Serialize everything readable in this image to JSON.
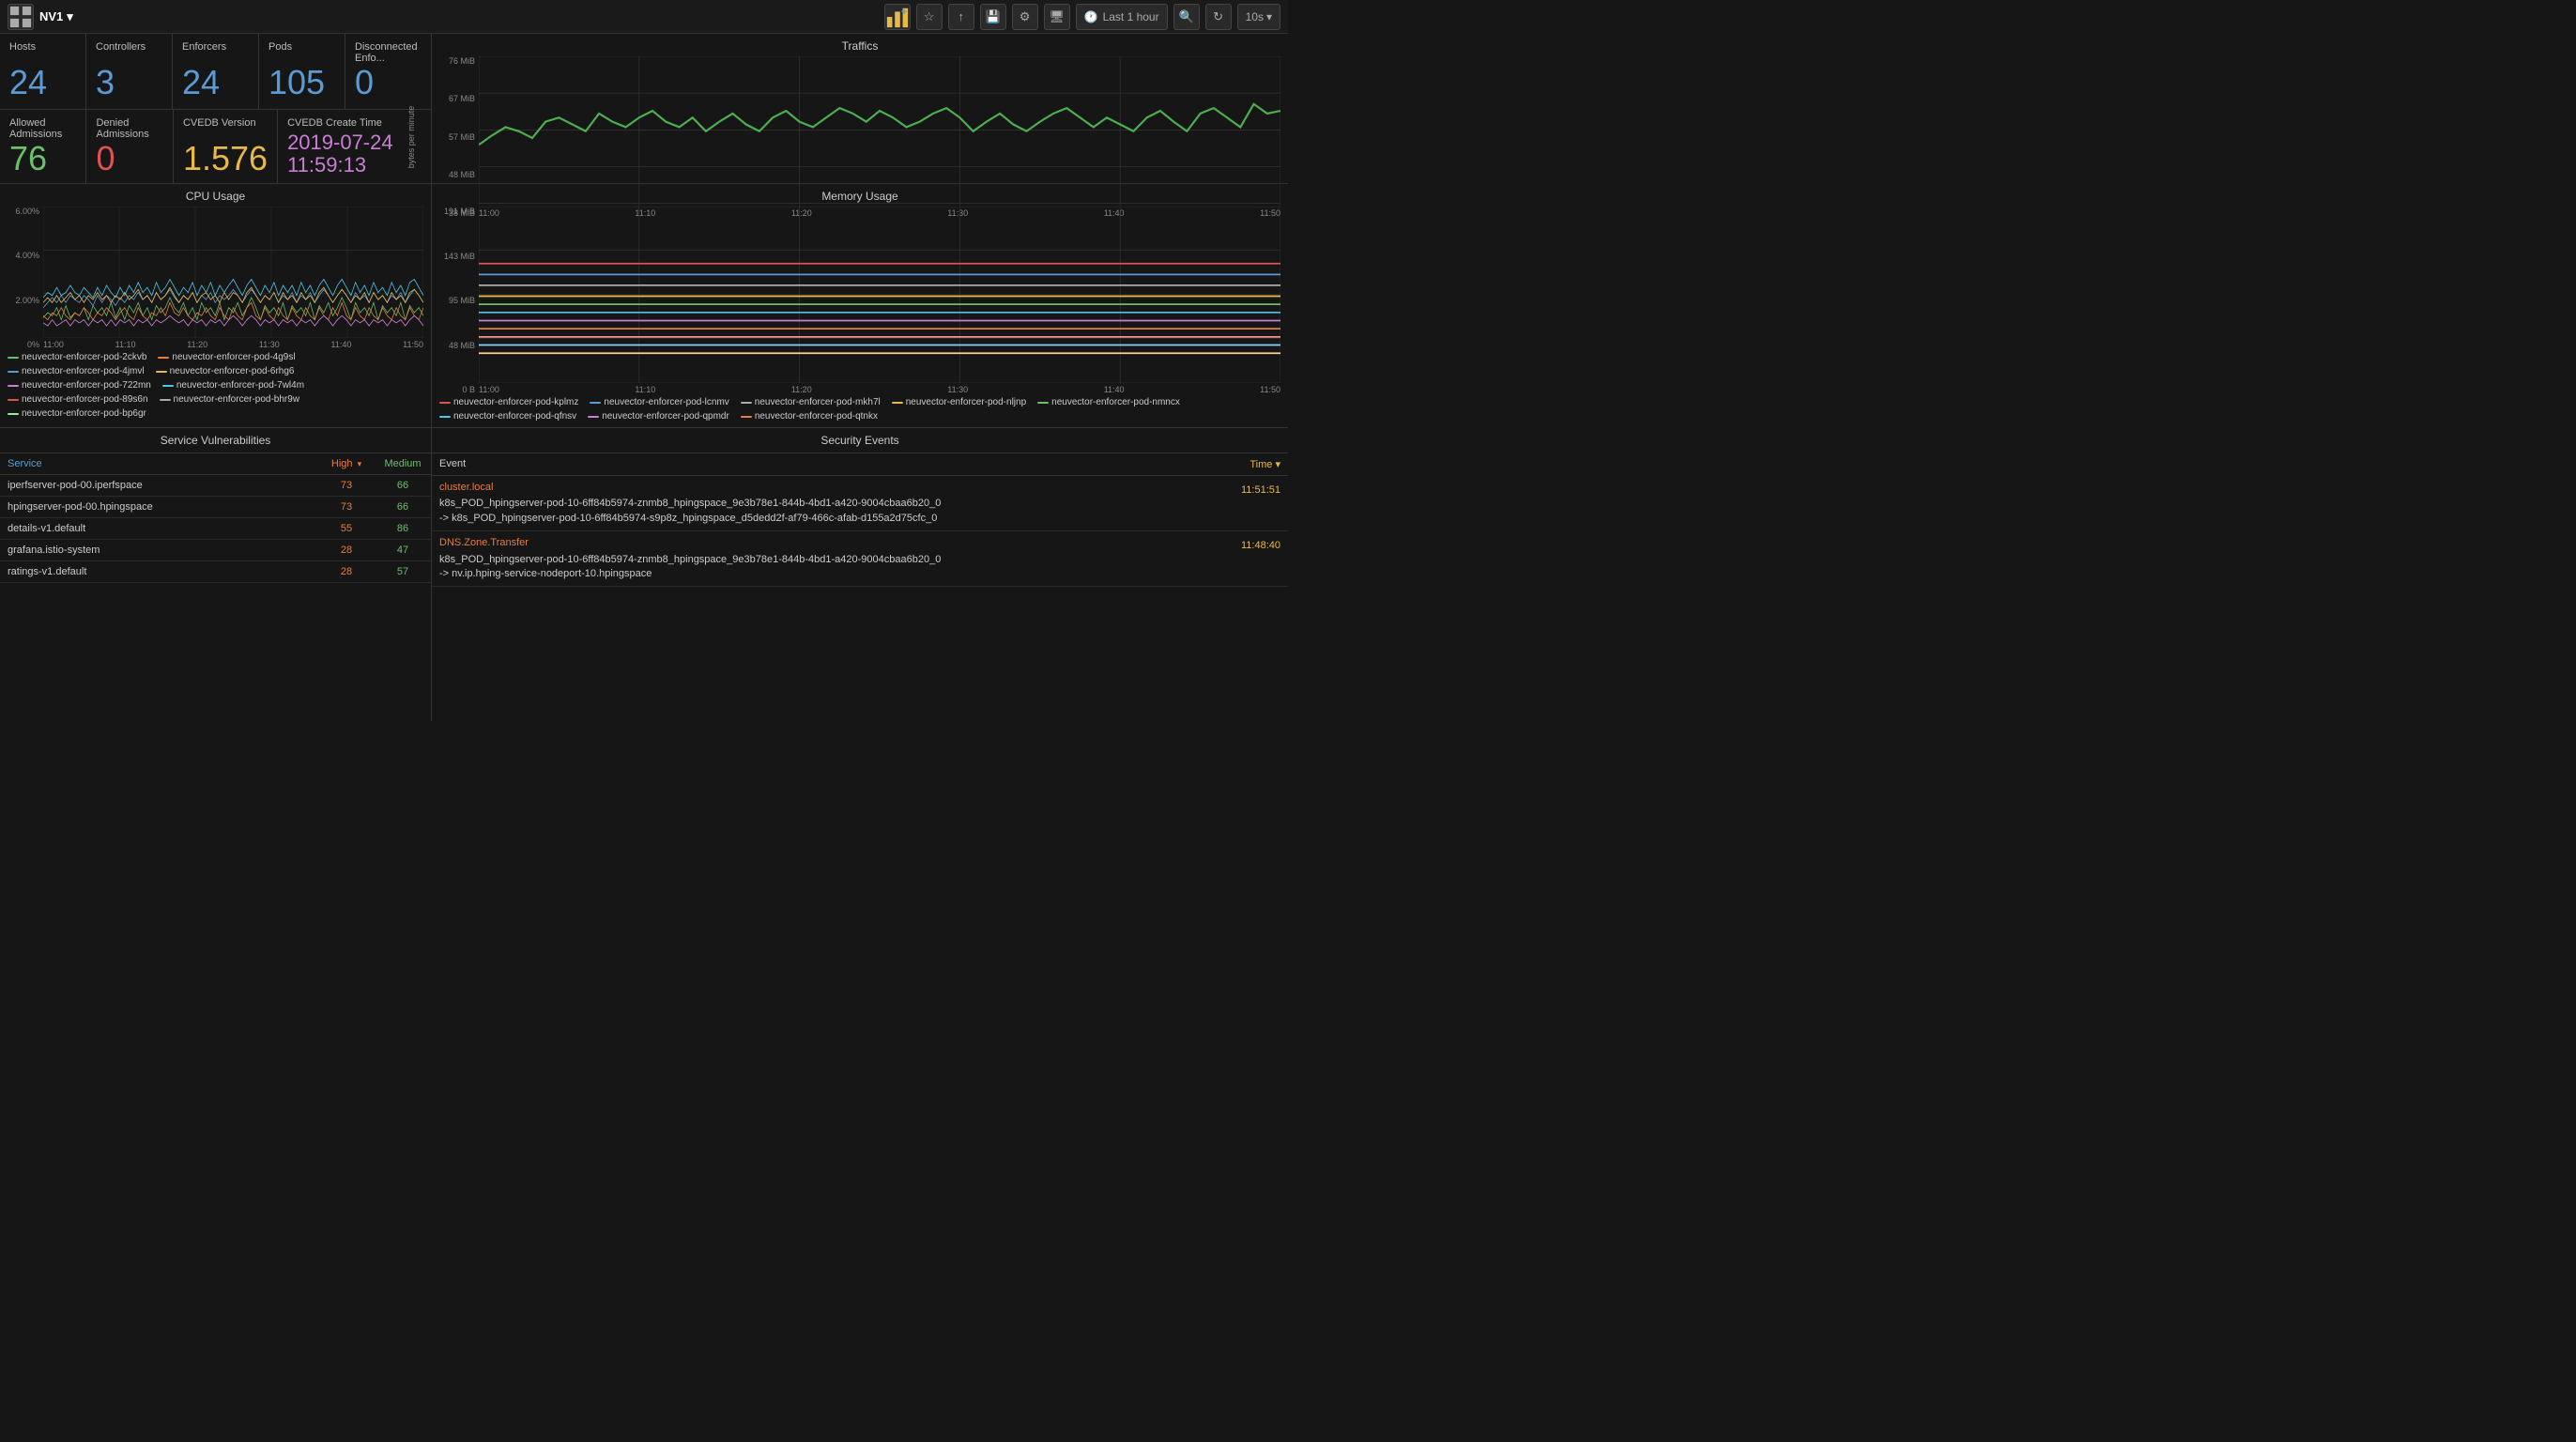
{
  "topbar": {
    "app_name": "NV1",
    "dropdown_icon": "▾",
    "last_hour_label": "Last 1 hour",
    "interval_label": "10s",
    "icons": [
      "chart-icon",
      "star-icon",
      "share-icon",
      "save-icon",
      "gear-icon",
      "monitor-icon",
      "search-icon",
      "refresh-icon"
    ]
  },
  "stats": {
    "row1": [
      {
        "id": "hosts",
        "title": "Hosts",
        "value": "24",
        "color": "blue"
      },
      {
        "id": "controllers",
        "title": "Controllers",
        "value": "3",
        "color": "blue"
      },
      {
        "id": "enforcers",
        "title": "Enforcers",
        "value": "24",
        "color": "blue"
      },
      {
        "id": "pods",
        "title": "Pods",
        "value": "105",
        "color": "blue"
      },
      {
        "id": "disconnected",
        "title": "Disconnected Enfo...",
        "value": "0",
        "color": "blue"
      }
    ],
    "row2": [
      {
        "id": "allowed",
        "title": "Allowed Admissions",
        "value": "76",
        "color": "green"
      },
      {
        "id": "denied",
        "title": "Denied Admissions",
        "value": "0",
        "color": "red"
      },
      {
        "id": "cvedb",
        "title": "CVEDB Version",
        "value": "1.576",
        "color": "yellow"
      },
      {
        "id": "cvedb_time",
        "title": "CVEDB Create Time",
        "value": "2019-07-24 11:59:13",
        "color": "purple"
      }
    ]
  },
  "traffics": {
    "title": "Traffics",
    "y_labels": [
      "76 MiB",
      "67 MiB",
      "57 MiB",
      "48 MiB",
      "38 MiB"
    ],
    "x_labels": [
      "11:00",
      "11:10",
      "11:20",
      "11:30",
      "11:40",
      "11:50"
    ],
    "y_axis_label": "bytes per minute"
  },
  "cpu_usage": {
    "title": "CPU Usage",
    "y_labels": [
      "6.00%",
      "4.00%",
      "2.00%",
      "0%"
    ],
    "x_labels": [
      "11:00",
      "11:10",
      "11:20",
      "11:30",
      "11:40",
      "11:50"
    ],
    "legend": [
      {
        "color": "#6abf69",
        "label": "neuvector-enforcer-pod-2ckvb"
      },
      {
        "color": "#e87c3e",
        "label": "neuvector-enforcer-pod-4g9sl"
      },
      {
        "color": "#5b9bd5",
        "label": "neuvector-enforcer-pod-4jmvl"
      },
      {
        "color": "#e8b84b",
        "label": "neuvector-enforcer-pod-6rhg6"
      },
      {
        "color": "#c97fd4",
        "label": "neuvector-enforcer-pod-722mn"
      },
      {
        "color": "#4bc8e8",
        "label": "neuvector-enforcer-pod-7wl4m"
      },
      {
        "color": "#e05252",
        "label": "neuvector-enforcer-pod-89s6n"
      },
      {
        "color": "#aaa",
        "label": "neuvector-enforcer-pod-bhr9w"
      },
      {
        "color": "#90ee90",
        "label": "neuvector-enforcer-pod-bp6gr"
      }
    ]
  },
  "memory_usage": {
    "title": "Memory Usage",
    "y_labels": [
      "191 MiB",
      "143 MiB",
      "95 MiB",
      "48 MiB",
      "0 B"
    ],
    "x_labels": [
      "11:00",
      "11:10",
      "11:20",
      "11:30",
      "11:40",
      "11:50"
    ],
    "legend": [
      {
        "color": "#e05252",
        "label": "neuvector-enforcer-pod-kplmz"
      },
      {
        "color": "#5b9bd5",
        "label": "neuvector-enforcer-pod-lcnmv"
      },
      {
        "color": "#aaa",
        "label": "neuvector-enforcer-pod-mkh7l"
      },
      {
        "color": "#e8b84b",
        "label": "neuvector-enforcer-pod-nljnp"
      },
      {
        "color": "#6abf69",
        "label": "neuvector-enforcer-pod-nmncx"
      },
      {
        "color": "#4bc8e8",
        "label": "neuvector-enforcer-pod-qfnsv"
      },
      {
        "color": "#c97fd4",
        "label": "neuvector-enforcer-pod-qpmdr"
      },
      {
        "color": "#e87c3e",
        "label": "neuvector-enforcer-pod-qtnkx"
      }
    ]
  },
  "service_vulnerabilities": {
    "title": "Service Vulnerabilities",
    "columns": [
      {
        "id": "service",
        "label": "Service",
        "color": "#5b9bd5"
      },
      {
        "id": "high",
        "label": "High",
        "color": "#e87c3e"
      },
      {
        "id": "medium",
        "label": "Medium",
        "color": "#6abf69"
      }
    ],
    "rows": [
      {
        "service": "iperfserver-pod-00.iperfspace",
        "high": "73",
        "medium": "66"
      },
      {
        "service": "hpingserver-pod-00.hpingspace",
        "high": "73",
        "medium": "66"
      },
      {
        "service": "details-v1.default",
        "high": "55",
        "medium": "86"
      },
      {
        "service": "grafana.istio-system",
        "high": "28",
        "medium": "47"
      },
      {
        "service": "ratings-v1.default",
        "high": "28",
        "medium": "57"
      }
    ]
  },
  "security_events": {
    "title": "Security Events",
    "col_event": "Event",
    "col_time": "Time ▾",
    "events": [
      {
        "type": "cluster.local",
        "type_color": "#e87c3e",
        "description": "k8s_POD_hpingserver-pod-10-6ff84b5974-znmb8_hpingspace_9e3b78e1-844b-4bd1-a420-9004cbaa6b20_0\n-> k8s_POD_hpingserver-pod-10-6ff84b5974-s9p8z_hpingspace_d5dedd2f-af79-466c-afab-d155a2d75cfc_0",
        "time": "11:51:51"
      },
      {
        "type": "DNS.Zone.Transfer",
        "type_color": "#e87c3e",
        "description": "k8s_POD_hpingserver-pod-10-6ff84b5974-znmb8_hpingspace_9e3b78e1-844b-4bd1-a420-9004cbaa6b20_0\n-> nv.ip.hping-service-nodeport-10.hpingspace",
        "time": "11:48:40"
      }
    ]
  }
}
